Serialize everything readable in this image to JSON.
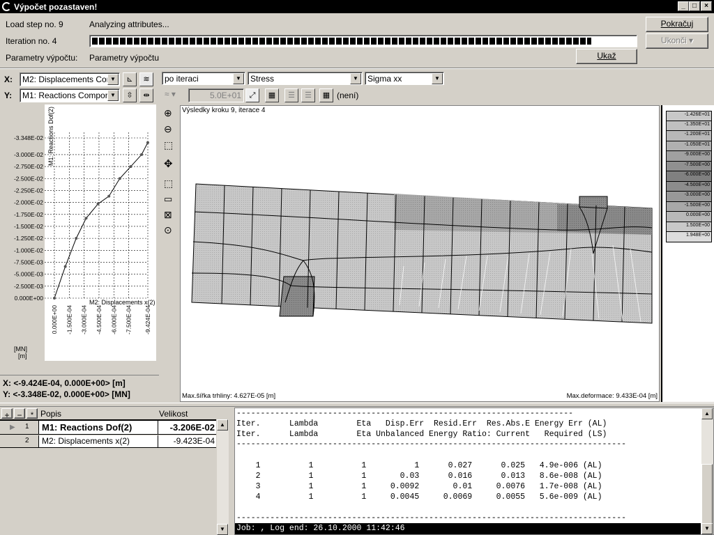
{
  "window": {
    "title": "Výpočet pozastaven!"
  },
  "status": {
    "load_step": "Load step no. 9",
    "analyzing": "Analyzing attributes...",
    "iteration": "Iteration no. 4",
    "params_label": "Parametry výpočtu:",
    "params_value": "Parametry výpočtu",
    "progress": 0.92
  },
  "buttons": {
    "continue": "Pokračuj",
    "stop": "Ukonči",
    "show": "Ukaž"
  },
  "axes_select": {
    "x_label": "X:",
    "x_value": "M2: Displacements Cor",
    "y_label": "Y:",
    "y_value": "M1: Reactions Compor"
  },
  "view_toolbar": {
    "mode": "po iteraci",
    "quantity": "Stress",
    "component": "Sigma xx",
    "scale_value": "5.0E+01",
    "none_label": "(není)"
  },
  "chart_data": {
    "type": "line",
    "ylabel": "M1: Reactions Dof(2)",
    "xlabel": "M2: Displacements x(2)",
    "units": [
      "[MN]",
      "[m]"
    ],
    "y_ticks": [
      "-3.348E-02",
      "-3.000E-02",
      "-2.750E-02",
      "-2.500E-02",
      "-2.250E-02",
      "-2.000E-02",
      "-1.750E-02",
      "-1.500E-02",
      "-1.250E-02",
      "-1.000E-02",
      "-7.500E-03",
      "-5.000E-03",
      "-2.500E-03",
      "0.000E+00"
    ],
    "x_ticks": [
      "0.000E+00",
      "-1.500E-04",
      "-3.000E-04",
      "-4.500E-04",
      "-6.000E-04",
      "-7.500E-04",
      "-9.424E-04"
    ],
    "xlim": [
      0,
      -0.0009424
    ],
    "ylim": [
      0,
      -0.03348
    ],
    "series": [
      {
        "x": [
          0,
          -0.00011,
          -0.00022,
          -0.00032,
          -0.00044,
          -0.00055,
          -0.00066,
          -0.00077,
          -0.00088,
          -0.000942
        ],
        "y": [
          0,
          -0.0066,
          -0.0125,
          -0.0167,
          -0.0197,
          -0.0213,
          -0.025,
          -0.0275,
          -0.03,
          -0.0325
        ]
      }
    ],
    "grid": true
  },
  "readout": {
    "x": "X: <-9.424E-04, 0.000E+00> [m]",
    "y": "Y: <-3.348E-02, 0.000E+00> [MN]"
  },
  "view": {
    "title": "Výsledky kroku 9, iterace 4",
    "crack_width": "Max.šířka trhliny:  4.627E-05 [m]",
    "max_deform": "Max.deformace:  9.433E-04 [m]"
  },
  "legend": {
    "values": [
      "-1.426E+01",
      "-1.350E+01",
      "-1.200E+01",
      "-1.050E+01",
      "-9.000E+00",
      "-7.500E+00",
      "-6.000E+00",
      "-4.500E+00",
      "-3.000E+00",
      "-1.500E+00",
      "0.000E+00",
      "1.500E+00",
      "1.948E+00"
    ],
    "colors": [
      "#c8c8c8",
      "#c0c0c0",
      "#b8b8b8",
      "#b0b0b0",
      "#a0a0a0",
      "#909090",
      "#808080",
      "#8c8c8c",
      "#989898",
      "#a8a8a8",
      "#b8b8b8",
      "#c8c8c8",
      "#dcdcdc"
    ]
  },
  "table": {
    "headers": [
      "Popis",
      "Velikost"
    ],
    "rows": [
      {
        "num": "1",
        "popis": "M1: Reactions Dof(2)",
        "velikost": "-3.206E-02"
      },
      {
        "num": "2",
        "popis": "M2: Displacements x(2)",
        "velikost": "-9.423E-04"
      }
    ]
  },
  "log": {
    "header1": "Iter.      Lambda        Eta   Disp.Err  Resid.Err  Res.Abs.E Energy Err (AL)",
    "header2": "Iter.      Lambda        Eta Unbalanced Energy Ratio: Current   Required (LS)",
    "rows": [
      "    1          1          1          1      0.027      0.025   4.9e-006 (AL)",
      "    2          1          1       0.03      0.016      0.013   8.6e-008 (AL)",
      "    3          1          1     0.0092       0.01     0.0076   1.7e-008 (AL)",
      "    4          1          1     0.0045     0.0069     0.0055   5.6e-009 (AL)"
    ],
    "footer": "Job: , Log end: 26.10.2000 11:42:46"
  }
}
